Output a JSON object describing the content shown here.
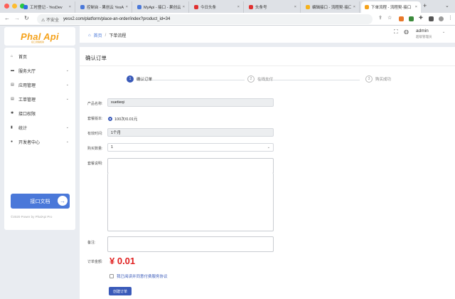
{
  "browser": {
    "tabs": [
      {
        "title": "工时登记 - YesDev",
        "color": "#2f6fe0",
        "active": false
      },
      {
        "title": "控制台 - 果创云 YesApi",
        "color": "#4a78d9",
        "active": false
      },
      {
        "title": "MyApi - 接口 - 果创云",
        "color": "#4a78d9",
        "active": false
      },
      {
        "title": "今日头条",
        "color": "#e03030",
        "active": false
      },
      {
        "title": "头条号",
        "color": "#e03030",
        "active": false
      },
      {
        "title": "编辑接口 - 流程契·接口",
        "color": "#f5b21b",
        "active": false
      },
      {
        "title": "下单流程 - 流程契·接口",
        "color": "#f5a21b",
        "active": true
      }
    ],
    "new_tab": "+",
    "tab_menu": "⌄",
    "back": "←",
    "forward": "→",
    "reload": "↻",
    "security_label": "⚠ 不安全",
    "url": "yesx2.com/platform/place-an-order/index?product_id=34"
  },
  "sidebar": {
    "logo": "Phal Api",
    "logo_sub": "接口流程框架",
    "items": [
      {
        "icon": "home-icon",
        "glyph": "⌂",
        "label": "首页",
        "has_chevron": false
      },
      {
        "icon": "service-icon",
        "glyph": "▬",
        "label": "服务大厅",
        "has_chevron": true
      },
      {
        "icon": "app-icon",
        "glyph": "▤",
        "label": "应用管理",
        "has_chevron": true
      },
      {
        "icon": "ticket-icon",
        "glyph": "▤",
        "label": "工单管理",
        "has_chevron": true
      },
      {
        "icon": "permission-icon",
        "glyph": "✱",
        "label": "接口权限",
        "has_chevron": false
      },
      {
        "icon": "stats-icon",
        "glyph": "▮",
        "label": "统计",
        "has_chevron": true
      },
      {
        "icon": "developer-icon",
        "glyph": "●",
        "label": "开发者中心",
        "has_chevron": true
      }
    ],
    "chevron": "⌄",
    "doc_button": "接口文档",
    "doc_arrow": "→",
    "powered": "©2020 Power by PhalApi Pro"
  },
  "header": {
    "home": "首页",
    "separator": "/",
    "current": "下单流程",
    "user": "admin",
    "role": "超级管理员"
  },
  "main": {
    "title": "确认订单",
    "steps": [
      {
        "num": "1",
        "label": "确认订单",
        "active": true
      },
      {
        "num": "2",
        "label": "在线支付",
        "active": false
      },
      {
        "num": "3",
        "label": "购买成功",
        "active": false
      }
    ],
    "form": {
      "product_label": "产品名称:",
      "product_value": "xuetieqi",
      "plan_label": "套餐版本:",
      "plan_value": "100次/0.01元",
      "period_label": "有效时间:",
      "period_value": "1个月",
      "qty_label": "购买数量:",
      "qty_value": "1",
      "desc_label": "套餐说明:",
      "desc_value": "",
      "remark_label": "备注:",
      "remark_value": "",
      "amount_label": "订单金额:",
      "amount_value": "¥ 0.01",
      "agree_text": "我已阅读并同意付费服务协议",
      "submit": "创建订单"
    }
  }
}
